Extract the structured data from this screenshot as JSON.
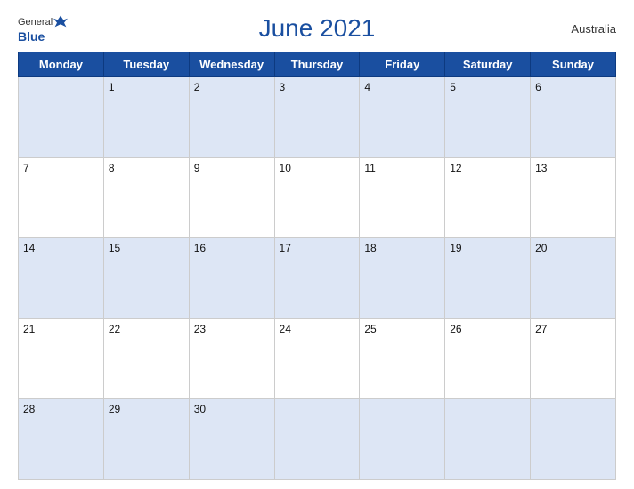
{
  "header": {
    "logo_general": "General",
    "logo_blue": "Blue",
    "title": "June 2021",
    "country": "Australia"
  },
  "days_of_week": [
    "Monday",
    "Tuesday",
    "Wednesday",
    "Thursday",
    "Friday",
    "Saturday",
    "Sunday"
  ],
  "weeks": [
    [
      {
        "num": "",
        "empty": true
      },
      {
        "num": "1"
      },
      {
        "num": "2"
      },
      {
        "num": "3"
      },
      {
        "num": "4"
      },
      {
        "num": "5"
      },
      {
        "num": "6"
      }
    ],
    [
      {
        "num": "7"
      },
      {
        "num": "8"
      },
      {
        "num": "9"
      },
      {
        "num": "10"
      },
      {
        "num": "11"
      },
      {
        "num": "12"
      },
      {
        "num": "13"
      }
    ],
    [
      {
        "num": "14"
      },
      {
        "num": "15"
      },
      {
        "num": "16"
      },
      {
        "num": "17"
      },
      {
        "num": "18"
      },
      {
        "num": "19"
      },
      {
        "num": "20"
      }
    ],
    [
      {
        "num": "21"
      },
      {
        "num": "22"
      },
      {
        "num": "23"
      },
      {
        "num": "24"
      },
      {
        "num": "25"
      },
      {
        "num": "26"
      },
      {
        "num": "27"
      }
    ],
    [
      {
        "num": "28"
      },
      {
        "num": "29"
      },
      {
        "num": "30"
      },
      {
        "num": "",
        "empty": true
      },
      {
        "num": "",
        "empty": true
      },
      {
        "num": "",
        "empty": true
      },
      {
        "num": "",
        "empty": true
      }
    ]
  ]
}
